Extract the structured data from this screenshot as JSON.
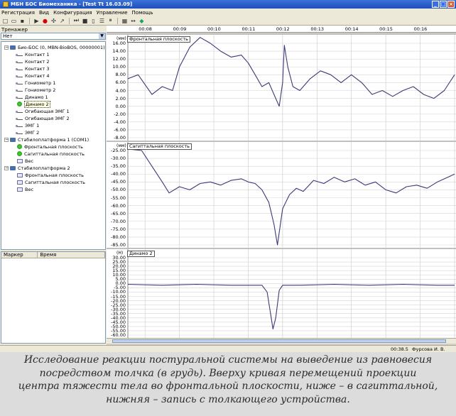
{
  "window": {
    "title": "МБН БОС Биомеханика - [Test Tt  16.03.09]"
  },
  "menu": [
    "Регистрация",
    "Вид",
    "Конфигурация",
    "Управление",
    "Помощь"
  ],
  "toolbar": {
    "icons": [
      "new-icon",
      "open-icon",
      "save-icon",
      "play-icon",
      "record-icon",
      "settings-icon",
      "sweep-icon",
      "step-icon",
      "stop-icon",
      "marker-icon",
      "list-icon",
      "pause-icon",
      "channels-icon",
      "cursor-icon",
      "export-icon"
    ]
  },
  "left_panel": {
    "label": "Тренажер",
    "combo_value": "Нет",
    "tree": [
      {
        "label": "Био-БОС (0, MBN-BioBOS, 00000001)",
        "level": 0,
        "kind": "device"
      },
      {
        "label": "Контакт 1",
        "level": 1,
        "kind": "sensor"
      },
      {
        "label": "Контакт 2",
        "level": 1,
        "kind": "sensor"
      },
      {
        "label": "Контакт 3",
        "level": 1,
        "kind": "sensor"
      },
      {
        "label": "Контакт 4",
        "level": 1,
        "kind": "sensor"
      },
      {
        "label": "Гониометр 1",
        "level": 1,
        "kind": "sensor"
      },
      {
        "label": "Гониометр 2",
        "level": 1,
        "kind": "sensor"
      },
      {
        "label": "Динамо 1",
        "level": 1,
        "kind": "sensor"
      },
      {
        "label": "Динамо 2",
        "level": 1,
        "kind": "active",
        "selected": true
      },
      {
        "label": "Огибающая ЭМГ 1",
        "level": 1,
        "kind": "sensor"
      },
      {
        "label": "Огибающая ЭМГ 2",
        "level": 1,
        "kind": "sensor"
      },
      {
        "label": "ЭМГ 1",
        "level": 1,
        "kind": "sensor"
      },
      {
        "label": "ЭМГ 2",
        "level": 1,
        "kind": "sensor"
      },
      {
        "label": "Стабилоплатформа 1 (COM1)",
        "level": 0,
        "kind": "device"
      },
      {
        "label": "Фронтальная плоскость",
        "level": 1,
        "kind": "active"
      },
      {
        "label": "Сагиттальная плоскость",
        "level": 1,
        "kind": "active"
      },
      {
        "label": "Вес",
        "level": 1,
        "kind": "graph"
      },
      {
        "label": "Стабилоплатформа 2",
        "level": 0,
        "kind": "device"
      },
      {
        "label": "Фронтальная плоскость",
        "level": 1,
        "kind": "graph"
      },
      {
        "label": "Сагиттальная плоскость",
        "level": 1,
        "kind": "graph"
      },
      {
        "label": "Вес",
        "level": 1,
        "kind": "graph"
      }
    ],
    "markers_columns": [
      "Маркер",
      "Время"
    ]
  },
  "time_axis": [
    "00:08",
    "00:09",
    "00:10",
    "00:11",
    "00:12",
    "00:13",
    "00:14",
    "00:15",
    "00:16"
  ],
  "chart_data": [
    {
      "type": "line",
      "title": "Фронтальная плоскость",
      "unit": "(мм)",
      "ylim": [
        -8,
        18
      ],
      "yticks": [
        "16.00",
        "14.00",
        "12.00",
        "10.00",
        "8.00",
        "6.00",
        "4.00",
        "2.00",
        "0.00",
        "-2.00",
        "-4.00",
        "-6.00",
        "-8.00"
      ],
      "x": [
        7.5,
        7.8,
        8.2,
        8.5,
        8.8,
        9.0,
        9.3,
        9.6,
        9.9,
        10.2,
        10.5,
        10.8,
        11.0,
        11.2,
        11.4,
        11.6,
        11.8,
        11.9,
        12.0,
        12.05,
        12.15,
        12.3,
        12.5,
        12.8,
        13.1,
        13.4,
        13.7,
        14.0,
        14.3,
        14.6,
        14.9,
        15.2,
        15.5,
        15.8,
        16.1,
        16.4,
        16.7,
        17.0
      ],
      "y": [
        7,
        8,
        3,
        5,
        4,
        10,
        15,
        17.5,
        16,
        14,
        12.5,
        13,
        11,
        8,
        5,
        6,
        2,
        0,
        6,
        15.5,
        10,
        5,
        4,
        7,
        9,
        8,
        6,
        8,
        6,
        3,
        4,
        2.5,
        4,
        5,
        3,
        2,
        4,
        8
      ]
    },
    {
      "type": "line",
      "title": "Сагиттальная плоскость",
      "unit": "(мм)",
      "ylim": [
        -85,
        -22.5
      ],
      "yticks": [
        "-25.00",
        "-30.00",
        "-35.00",
        "-40.00",
        "-45.00",
        "-50.00",
        "-55.00",
        "-60.00",
        "-65.00",
        "-70.00",
        "-75.00",
        "-80.00",
        "-85.00"
      ],
      "x": [
        7.5,
        7.9,
        8.2,
        8.5,
        8.7,
        9.0,
        9.3,
        9.6,
        9.9,
        10.2,
        10.5,
        10.8,
        11.0,
        11.2,
        11.4,
        11.6,
        11.75,
        11.85,
        12.0,
        12.2,
        12.4,
        12.6,
        12.9,
        13.2,
        13.5,
        13.8,
        14.1,
        14.4,
        14.7,
        15.0,
        15.3,
        15.6,
        15.9,
        16.2,
        16.5,
        16.8,
        17.0
      ],
      "y": [
        -24,
        -25,
        -35,
        -45,
        -52,
        -48,
        -50,
        -46,
        -45,
        -47,
        -44,
        -43,
        -45,
        -46,
        -50,
        -58,
        -72,
        -85,
        -62,
        -53,
        -49,
        -51,
        -44,
        -46,
        -42,
        -45,
        -43,
        -47,
        -45,
        -50,
        -52,
        -48,
        -47,
        -49,
        -45,
        -42,
        -40
      ]
    },
    {
      "type": "line",
      "title": "Динамо 2",
      "unit": "(Н)",
      "ylim": [
        -60,
        30
      ],
      "yticks": [
        "30.00",
        "25.00",
        "20.00",
        "15.00",
        "10.00",
        "5.00",
        "0.00",
        "-5.00",
        "-10.00",
        "-15.00",
        "-20.00",
        "-25.00",
        "-30.00",
        "-35.00",
        "-40.00",
        "-45.00",
        "-50.00",
        "-55.00",
        "-60.00"
      ],
      "x": [
        7.5,
        8.5,
        9.5,
        10.5,
        11.4,
        11.55,
        11.65,
        11.72,
        11.8,
        11.9,
        12.0,
        12.5,
        13.5,
        14.5,
        15.5,
        16.5,
        17.0
      ],
      "y": [
        -1,
        -2,
        -1,
        -2,
        -2,
        -10,
        -35,
        -53,
        -40,
        -8,
        -2,
        -2,
        -1,
        -2,
        -1,
        -2,
        -2
      ]
    }
  ],
  "status": {
    "time": "00:38.5",
    "operator": "Фурсова И. В."
  },
  "caption": [
    "Исследование реакции постуральной системы на выведение из равновесия",
    "посредством толчка (в грудь). Вверху кривая перемещений проекции",
    "центра тяжести тела во фронтальной плоскости, ниже – в сагиттальной,",
    "нижняя – запись с толкающего устройства."
  ]
}
